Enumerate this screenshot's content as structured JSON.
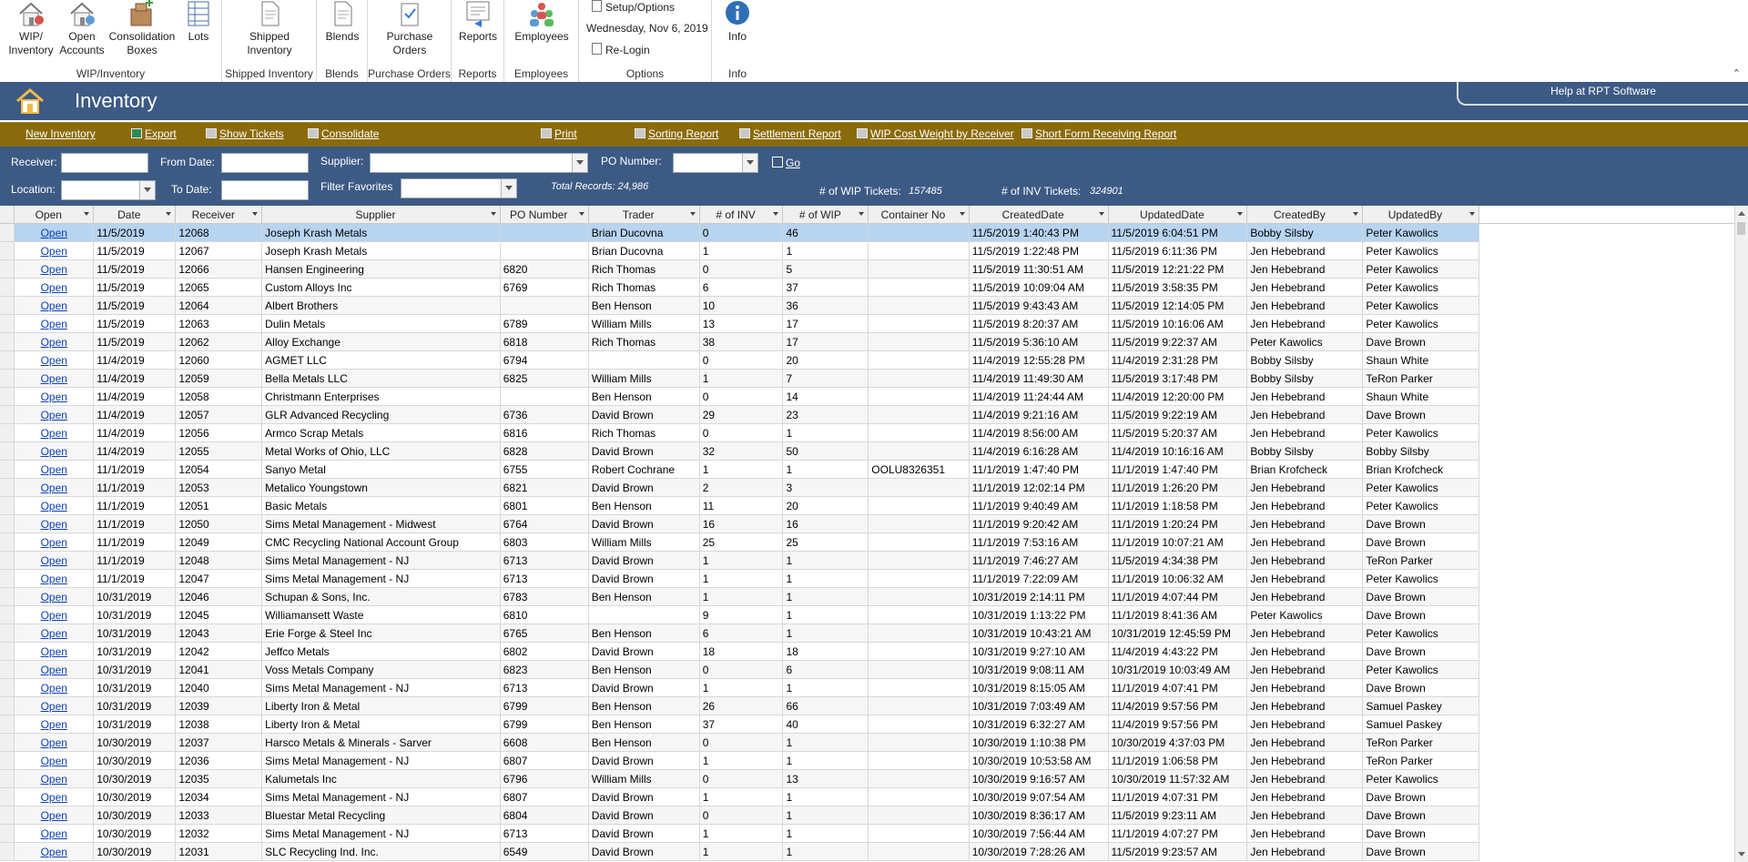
{
  "ribbon": {
    "groups": [
      {
        "label": "WIP/Inventory",
        "buttons": [
          "WIP/\nInventory",
          "Open\nAccounts",
          "Consolidation\nBoxes",
          "Lots"
        ]
      },
      {
        "label": "Shipped Inventory",
        "buttons": [
          "Shipped\nInventory"
        ]
      },
      {
        "label": "Blends",
        "buttons": [
          "Blends"
        ]
      },
      {
        "label": "Purchase Orders",
        "buttons": [
          "Purchase\nOrders"
        ]
      },
      {
        "label": "Reports",
        "buttons": [
          "Reports"
        ]
      },
      {
        "label": "Employees",
        "buttons": [
          "Employees"
        ]
      },
      {
        "label": "Options",
        "items": [
          "Setup/Options",
          "Wednesday, Nov 6, 2019",
          "Re-Login"
        ]
      },
      {
        "label": "Info",
        "buttons": [
          "Info"
        ]
      }
    ]
  },
  "title": {
    "text": "Inventory",
    "help": "Help at RPT Software"
  },
  "toolbar": {
    "new_inventory": "New Inventory",
    "export": "Export",
    "show_tickets": "Show Tickets",
    "consolidate": "Consolidate",
    "print": "Print",
    "sorting_report": "Sorting Report",
    "settlement_report": "Settlement Report",
    "wip_cost": "WIP Cost Weight by Receiver",
    "short_form": "Short Form Receiving Report"
  },
  "filters": {
    "receiver_label": "Receiver:",
    "from_date_label": "From Date:",
    "supplier_label": "Supplier:",
    "po_number_label": "PO Number:",
    "go_label": "Go",
    "location_label": "Location:",
    "to_date_label": "To Date:",
    "filter_favorites_label": "Filter Favorites",
    "total_records": "Total Records: 24,986",
    "wip_tickets_label": "# of WIP Tickets:",
    "wip_tickets_value": "157485",
    "inv_tickets_label": "# of INV Tickets:",
    "inv_tickets_value": "324901"
  },
  "grid": {
    "columns": [
      "Open",
      "Date",
      "Receiver",
      "Supplier",
      "PO Number",
      "Trader",
      "# of INV",
      "# of WIP",
      "Container No",
      "CreatedDate",
      "UpdatedDate",
      "CreatedBy",
      "UpdatedBy"
    ],
    "rows": [
      [
        "Open",
        "11/5/2019",
        "12068",
        "Joseph Krash Metals",
        "",
        "Brian Ducovna",
        "0",
        "46",
        "",
        "11/5/2019 1:40:43 PM",
        "11/5/2019 6:04:51 PM",
        "Bobby Silsby",
        "Peter Kawolics"
      ],
      [
        "Open",
        "11/5/2019",
        "12067",
        "Joseph Krash Metals",
        "",
        "Brian Ducovna",
        "1",
        "1",
        "",
        "11/5/2019 1:22:48 PM",
        "11/5/2019 6:11:36 PM",
        "Jen Hebebrand",
        "Peter Kawolics"
      ],
      [
        "Open",
        "11/5/2019",
        "12066",
        "Hansen Engineering",
        "6820",
        "Rich Thomas",
        "0",
        "5",
        "",
        "11/5/2019 11:30:51 AM",
        "11/5/2019 12:21:22 PM",
        "Jen Hebebrand",
        "Peter Kawolics"
      ],
      [
        "Open",
        "11/5/2019",
        "12065",
        "Custom Alloys Inc",
        "6769",
        "Rich Thomas",
        "6",
        "37",
        "",
        "11/5/2019 10:09:04 AM",
        "11/5/2019 3:58:35 PM",
        "Jen Hebebrand",
        "Peter Kawolics"
      ],
      [
        "Open",
        "11/5/2019",
        "12064",
        "Albert Brothers",
        "",
        "Ben Henson",
        "10",
        "36",
        "",
        "11/5/2019 9:43:43 AM",
        "11/5/2019 12:14:05 PM",
        "Jen Hebebrand",
        "Peter Kawolics"
      ],
      [
        "Open",
        "11/5/2019",
        "12063",
        "Dulin Metals",
        "6789",
        "William Mills",
        "13",
        "17",
        "",
        "11/5/2019 8:20:37 AM",
        "11/5/2019 10:16:06 AM",
        "Jen Hebebrand",
        "Peter Kawolics"
      ],
      [
        "Open",
        "11/5/2019",
        "12062",
        "Alloy Exchange",
        "6818",
        "Rich Thomas",
        "38",
        "17",
        "",
        "11/5/2019 5:36:10 AM",
        "11/5/2019 9:22:37 AM",
        "Peter Kawolics",
        "Dave Brown"
      ],
      [
        "Open",
        "11/4/2019",
        "12060",
        "AGMET LLC",
        "6794",
        "",
        "0",
        "20",
        "",
        "11/4/2019 12:55:28 PM",
        "11/4/2019 2:31:28 PM",
        "Bobby Silsby",
        "Shaun White"
      ],
      [
        "Open",
        "11/4/2019",
        "12059",
        "Bella Metals LLC",
        "6825",
        "William Mills",
        "1",
        "7",
        "",
        "11/4/2019 11:49:30 AM",
        "11/5/2019 3:17:48 PM",
        "Bobby Silsby",
        "TeRon Parker"
      ],
      [
        "Open",
        "11/4/2019",
        "12058",
        "Christmann Enterprises",
        "",
        "Ben Henson",
        "0",
        "14",
        "",
        "11/4/2019 11:24:44 AM",
        "11/4/2019 12:20:00 PM",
        "Jen Hebebrand",
        "Shaun White"
      ],
      [
        "Open",
        "11/4/2019",
        "12057",
        "GLR Advanced Recycling",
        "6736",
        "David Brown",
        "29",
        "23",
        "",
        "11/4/2019 9:21:16 AM",
        "11/5/2019 9:22:19 AM",
        "Jen Hebebrand",
        "Dave Brown"
      ],
      [
        "Open",
        "11/4/2019",
        "12056",
        "Armco Scrap Metals",
        "6816",
        "Rich Thomas",
        "0",
        "1",
        "",
        "11/4/2019 8:56:00 AM",
        "11/5/2019 5:20:37 AM",
        "Jen Hebebrand",
        "Peter Kawolics"
      ],
      [
        "Open",
        "11/4/2019",
        "12055",
        "Metal Works of Ohio, LLC",
        "6828",
        "David Brown",
        "32",
        "50",
        "",
        "11/4/2019 6:16:28 AM",
        "11/4/2019 10:16:16 AM",
        "Bobby Silsby",
        "Bobby Silsby"
      ],
      [
        "Open",
        "11/1/2019",
        "12054",
        "Sanyo Metal",
        "6755",
        "Robert Cochrane",
        "1",
        "1",
        "OOLU8326351",
        "11/1/2019 1:47:40 PM",
        "11/1/2019 1:47:40 PM",
        "Brian Krofcheck",
        "Brian Krofcheck"
      ],
      [
        "Open",
        "11/1/2019",
        "12053",
        "Metalico Youngstown",
        "6821",
        "David Brown",
        "2",
        "3",
        "",
        "11/1/2019 12:02:14 PM",
        "11/1/2019 1:26:20 PM",
        "Jen Hebebrand",
        "Peter Kawolics"
      ],
      [
        "Open",
        "11/1/2019",
        "12051",
        "Basic Metals",
        "6801",
        "Ben Henson",
        "11",
        "20",
        "",
        "11/1/2019 9:40:49 AM",
        "11/1/2019 1:18:58 PM",
        "Jen Hebebrand",
        "Peter Kawolics"
      ],
      [
        "Open",
        "11/1/2019",
        "12050",
        "Sims Metal Management - Midwest",
        "6764",
        "David Brown",
        "16",
        "16",
        "",
        "11/1/2019 9:20:42 AM",
        "11/1/2019 1:20:24 PM",
        "Jen Hebebrand",
        "Dave Brown"
      ],
      [
        "Open",
        "11/1/2019",
        "12049",
        "CMC Recycling National Account Group",
        "6803",
        "William Mills",
        "25",
        "25",
        "",
        "11/1/2019 7:53:16 AM",
        "11/1/2019 10:07:21 AM",
        "Jen Hebebrand",
        "Dave Brown"
      ],
      [
        "Open",
        "11/1/2019",
        "12048",
        "Sims Metal Management - NJ",
        "6713",
        "David Brown",
        "1",
        "1",
        "",
        "11/1/2019 7:46:27 AM",
        "11/5/2019 4:34:38 PM",
        "Jen Hebebrand",
        "TeRon Parker"
      ],
      [
        "Open",
        "11/1/2019",
        "12047",
        "Sims Metal Management - NJ",
        "6713",
        "David Brown",
        "1",
        "1",
        "",
        "11/1/2019 7:22:09 AM",
        "11/1/2019 10:06:32 AM",
        "Jen Hebebrand",
        "Peter Kawolics"
      ],
      [
        "Open",
        "10/31/2019",
        "12046",
        "Schupan & Sons, Inc.",
        "6783",
        "Ben Henson",
        "1",
        "1",
        "",
        "10/31/2019 2:14:11 PM",
        "11/1/2019 4:07:44 PM",
        "Jen Hebebrand",
        "Dave Brown"
      ],
      [
        "Open",
        "10/31/2019",
        "12045",
        "Williamansett Waste",
        "6810",
        "",
        "9",
        "1",
        "",
        "10/31/2019 1:13:22 PM",
        "11/1/2019 8:41:36 AM",
        "Peter Kawolics",
        "Dave Brown"
      ],
      [
        "Open",
        "10/31/2019",
        "12043",
        "Erie Forge & Steel Inc",
        "6765",
        "Ben Henson",
        "6",
        "1",
        "",
        "10/31/2019 10:43:21 AM",
        "10/31/2019 12:45:59 PM",
        "Jen Hebebrand",
        "Peter Kawolics"
      ],
      [
        "Open",
        "10/31/2019",
        "12042",
        "Jeffco Metals",
        "6802",
        "David Brown",
        "18",
        "18",
        "",
        "10/31/2019 9:27:10 AM",
        "11/4/2019 4:43:22 PM",
        "Jen Hebebrand",
        "Dave Brown"
      ],
      [
        "Open",
        "10/31/2019",
        "12041",
        "Voss Metals Company",
        "6823",
        "Ben Henson",
        "0",
        "6",
        "",
        "10/31/2019 9:08:11 AM",
        "10/31/2019 10:03:49 AM",
        "Jen Hebebrand",
        "Peter Kawolics"
      ],
      [
        "Open",
        "10/31/2019",
        "12040",
        "Sims Metal Management - NJ",
        "6713",
        "David Brown",
        "1",
        "1",
        "",
        "10/31/2019 8:15:05 AM",
        "11/1/2019 4:07:41 PM",
        "Jen Hebebrand",
        "Dave Brown"
      ],
      [
        "Open",
        "10/31/2019",
        "12039",
        "Liberty Iron & Metal",
        "6799",
        "Ben Henson",
        "26",
        "66",
        "",
        "10/31/2019 7:03:49 AM",
        "11/4/2019 9:57:56 PM",
        "Jen Hebebrand",
        "Samuel Paskey"
      ],
      [
        "Open",
        "10/31/2019",
        "12038",
        "Liberty Iron & Metal",
        "6799",
        "Ben Henson",
        "37",
        "40",
        "",
        "10/31/2019 6:32:27 AM",
        "11/4/2019 9:57:56 PM",
        "Jen Hebebrand",
        "Samuel Paskey"
      ],
      [
        "Open",
        "10/30/2019",
        "12037",
        "Harsco Metals & Minerals - Sarver",
        "6608",
        "Ben Henson",
        "0",
        "1",
        "",
        "10/30/2019 1:10:38 PM",
        "10/30/2019 4:37:03 PM",
        "Jen Hebebrand",
        "TeRon Parker"
      ],
      [
        "Open",
        "10/30/2019",
        "12036",
        "Sims Metal Management - NJ",
        "6807",
        "David Brown",
        "1",
        "1",
        "",
        "10/30/2019 10:53:58 AM",
        "11/1/2019 1:06:58 PM",
        "Jen Hebebrand",
        "TeRon Parker"
      ],
      [
        "Open",
        "10/30/2019",
        "12035",
        "Kalumetals Inc",
        "6796",
        "William Mills",
        "0",
        "13",
        "",
        "10/30/2019 9:16:57 AM",
        "10/30/2019 11:57:32 AM",
        "Jen Hebebrand",
        "Peter Kawolics"
      ],
      [
        "Open",
        "10/30/2019",
        "12034",
        "Sims Metal Management - NJ",
        "6807",
        "David Brown",
        "1",
        "1",
        "",
        "10/30/2019 9:07:54 AM",
        "11/1/2019 4:07:31 PM",
        "Jen Hebebrand",
        "Dave Brown"
      ],
      [
        "Open",
        "10/30/2019",
        "12033",
        "Bluestar Metal Recycling",
        "6804",
        "David Brown",
        "0",
        "1",
        "",
        "10/30/2019 8:36:17 AM",
        "11/5/2019 9:23:11 AM",
        "Jen Hebebrand",
        "Dave Brown"
      ],
      [
        "Open",
        "10/30/2019",
        "12032",
        "Sims Metal Management - NJ",
        "6713",
        "David Brown",
        "1",
        "1",
        "",
        "10/30/2019 7:56:44 AM",
        "11/1/2019 4:07:27 PM",
        "Jen Hebebrand",
        "Dave Brown"
      ],
      [
        "Open",
        "10/30/2019",
        "12031",
        "SLC Recycling Ind. Inc.",
        "6549",
        "David Brown",
        "1",
        "1",
        "",
        "10/30/2019 7:28:26 AM",
        "11/5/2019 9:23:57 AM",
        "Jen Hebebrand",
        "Dave Brown"
      ]
    ]
  }
}
